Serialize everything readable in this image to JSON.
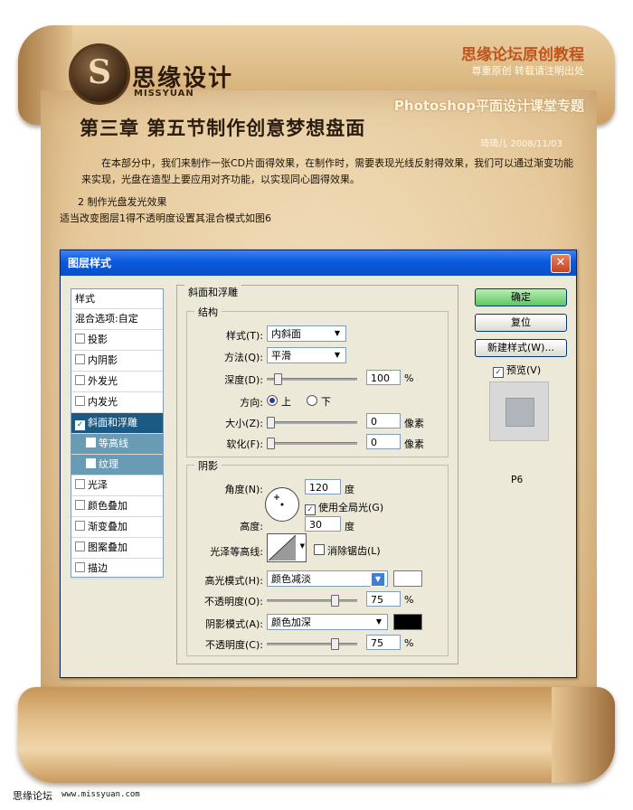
{
  "header": {
    "logo_title": "思缘设计",
    "logo_sub": "MISSYUAN",
    "site_title": "思缘论坛原创教程",
    "site_note": "尊重原创  转载请注明出处",
    "topic": "Photoshop平面设计课堂专题"
  },
  "article": {
    "chapter": "第三章 第五节制作创意梦想盘面",
    "byline": "琦琦儿 2008/11/03",
    "intro": "在本部分中，我们来制作一张CD片面得效果，在制作时，需要表现光线反射得效果，我们可以通过渐变功能来实现，光盘在造型上要应用对齐功能，以实现同心圆得效果。",
    "step": "2 制作光盘发光效果",
    "step_desc": "适当改变图层1得不透明度设置其混合模式如图6"
  },
  "dialog": {
    "title": "图层样式",
    "close": "✕",
    "sidebar": {
      "header": "样式",
      "blend": "混合选项:自定",
      "items": [
        {
          "label": "投影",
          "checked": false
        },
        {
          "label": "内阴影",
          "checked": false
        },
        {
          "label": "外发光",
          "checked": false
        },
        {
          "label": "内发光",
          "checked": false
        },
        {
          "label": "斜面和浮雕",
          "checked": true
        },
        {
          "label": "等高线",
          "checked": false
        },
        {
          "label": "纹理",
          "checked": false
        },
        {
          "label": "光泽",
          "checked": false
        },
        {
          "label": "颜色叠加",
          "checked": false
        },
        {
          "label": "渐变叠加",
          "checked": false
        },
        {
          "label": "图案叠加",
          "checked": false
        },
        {
          "label": "描边",
          "checked": false
        }
      ]
    },
    "panel_title": "斜面和浮雕",
    "structure": {
      "title": "结构",
      "style_label": "样式(T):",
      "style_value": "内斜面",
      "technique_label": "方法(Q):",
      "technique_value": "平滑",
      "depth_label": "深度(D):",
      "depth_value": "100",
      "depth_unit": "%",
      "depth_slider": 0.08,
      "direction_label": "方向:",
      "dir_up": "上",
      "dir_down": "下",
      "size_label": "大小(Z):",
      "size_value": "0",
      "size_unit": "像素",
      "soften_label": "软化(F):",
      "soften_value": "0",
      "soften_unit": "像素"
    },
    "shading": {
      "title": "阴影",
      "angle_label": "角度(N):",
      "angle_value": "120",
      "angle_unit": "度",
      "global_light": "使用全局光(G)",
      "altitude_label": "高度:",
      "altitude_value": "30",
      "altitude_unit": "度",
      "gloss_label": "光泽等高线:",
      "anti_alias": "消除锯齿(L)",
      "highlight_label": "高光模式(H):",
      "highlight_value": "颜色减淡",
      "highlight_color": "#ffffff",
      "hl_opacity_label": "不透明度(O):",
      "hl_opacity_value": "75",
      "shadow_label": "阴影模式(A):",
      "shadow_value": "颜色加深",
      "shadow_color": "#000000",
      "sh_opacity_label": "不透明度(C):",
      "sh_opacity_value": "75",
      "percent": "%"
    },
    "buttons": {
      "ok": "确定",
      "reset": "复位",
      "new_style": "新建样式(W)...",
      "preview": "预览(V)"
    },
    "figure_label": "P6"
  },
  "footer": {
    "name": "思缘论坛",
    "url": "www.missyuan.com"
  }
}
